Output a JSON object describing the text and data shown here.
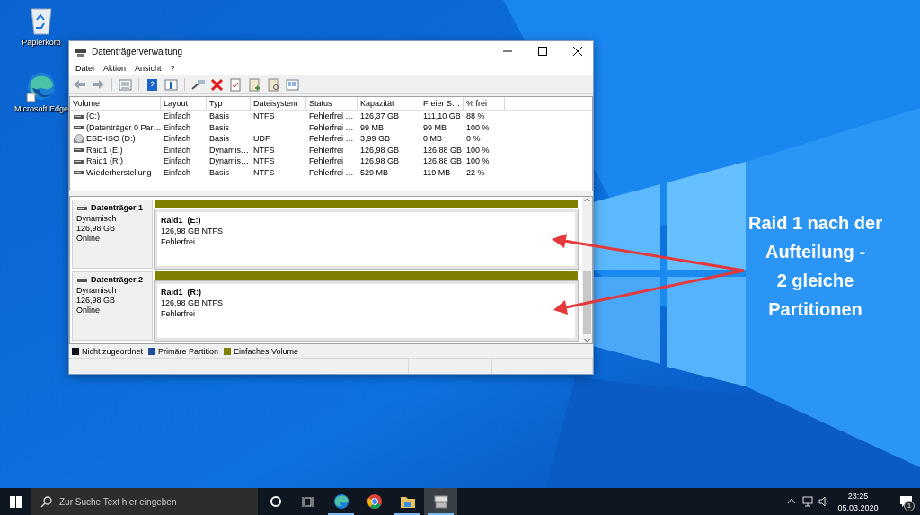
{
  "desktop_icons": [
    {
      "label": "Papierkorb",
      "kind": "recycle"
    },
    {
      "label": "Microsoft Edge",
      "kind": "edge"
    }
  ],
  "window": {
    "title": "Datenträgerverwaltung",
    "menu": [
      "Datei",
      "Aktion",
      "Ansicht",
      "?"
    ],
    "volumes": {
      "columns": [
        "Volume",
        "Layout",
        "Typ",
        "Dateisystem",
        "Status",
        "Kapazität",
        "Freier S…",
        "% frei"
      ],
      "rows": [
        {
          "kind": "disk",
          "cells": [
            "(C:)",
            "Einfach",
            "Basis",
            "NTFS",
            "Fehlerfrei …",
            "126,37 GB",
            "111,10 GB",
            "88 %"
          ]
        },
        {
          "kind": "disk",
          "cells": [
            "(Datenträger 0 Par…",
            "Einfach",
            "Basis",
            "",
            "Fehlerfrei …",
            "99 MB",
            "99 MB",
            "100 %"
          ]
        },
        {
          "kind": "cd",
          "cells": [
            "ESD-ISO (D:)",
            "Einfach",
            "Basis",
            "UDF",
            "Fehlerfrei …",
            "3,99 GB",
            "0 MB",
            "0 %"
          ]
        },
        {
          "kind": "disk",
          "cells": [
            "Raid1 (E:)",
            "Einfach",
            "Dynamis…",
            "NTFS",
            "Fehlerfrei",
            "126,98 GB",
            "126,88 GB",
            "100 %"
          ]
        },
        {
          "kind": "disk",
          "cells": [
            "Raid1 (R:)",
            "Einfach",
            "Dynamis…",
            "NTFS",
            "Fehlerfrei",
            "126,98 GB",
            "126,88 GB",
            "100 %"
          ]
        },
        {
          "kind": "disk",
          "cells": [
            "Wiederherstellung",
            "Einfach",
            "Basis",
            "NTFS",
            "Fehlerfrei …",
            "529 MB",
            "119 MB",
            "22 %"
          ]
        }
      ]
    },
    "disks": [
      {
        "name": "Datenträger 1",
        "type": "Dynamisch",
        "size": "126,98 GB",
        "state": "Online",
        "partition": {
          "kind": "simple",
          "name": "Raid1  (E:)",
          "size": "126,98 GB NTFS",
          "status": "Fehlerfrei"
        }
      },
      {
        "name": "Datenträger 2",
        "type": "Dynamisch",
        "size": "126,98 GB",
        "state": "Online",
        "partition": {
          "kind": "simple",
          "name": "Raid1  (R:)",
          "size": "126,98 GB NTFS",
          "status": "Fehlerfrei"
        }
      }
    ],
    "legend": [
      {
        "label": "Nicht zugeordnet",
        "color": "#0b1118"
      },
      {
        "label": "Primäre Partition",
        "color": "#1f4e9c"
      },
      {
        "label": "Einfaches Volume",
        "color": "#808000"
      }
    ]
  },
  "annotation": {
    "text": "Raid 1 nach der\nAufteilung -\n2 gleiche\nPartitionen"
  },
  "taskbar": {
    "search": {
      "placeholder": "Zur Suche Text hier eingeben"
    },
    "apps": [
      {
        "kind": "edge",
        "running": true,
        "selected": false
      },
      {
        "kind": "chrome",
        "running": false,
        "selected": false
      },
      {
        "kind": "explorer",
        "running": true,
        "selected": false
      },
      {
        "kind": "diskmgmt",
        "running": true,
        "selected": true
      }
    ],
    "time": "23:25",
    "date": "05.03.2020",
    "notification_count": "1"
  }
}
